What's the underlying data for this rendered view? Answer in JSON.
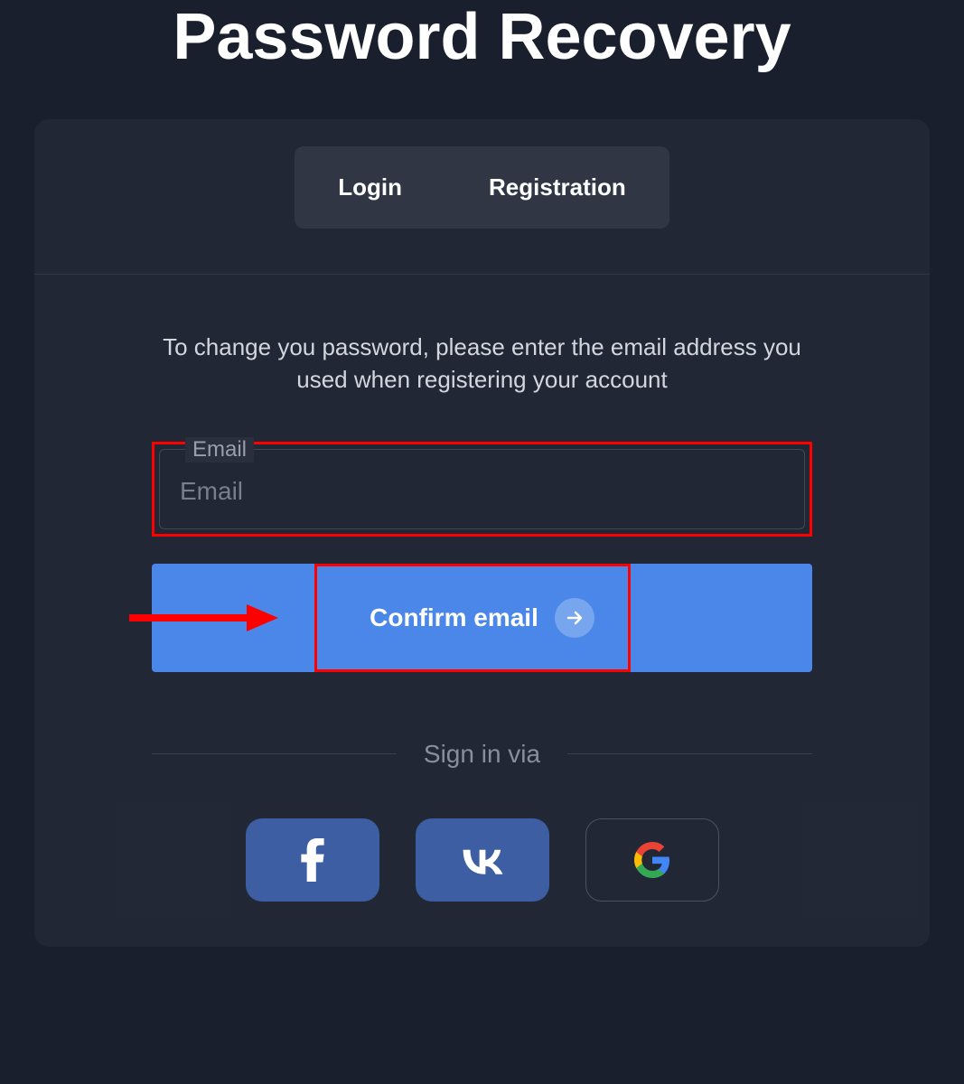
{
  "page": {
    "title": "Password Recovery"
  },
  "tabs": {
    "login": "Login",
    "registration": "Registration"
  },
  "instruction": "To change you password, please enter the email address you used when registering your account",
  "field": {
    "label": "Email",
    "placeholder": "Email",
    "value": ""
  },
  "confirm": {
    "label": "Confirm email"
  },
  "divider": {
    "text": "Sign in via"
  },
  "social": {
    "facebook": "facebook",
    "vk": "vk",
    "google": "google"
  },
  "annotations": {
    "highlight_color": "#ff0000",
    "arrow_color": "#ff0000"
  }
}
